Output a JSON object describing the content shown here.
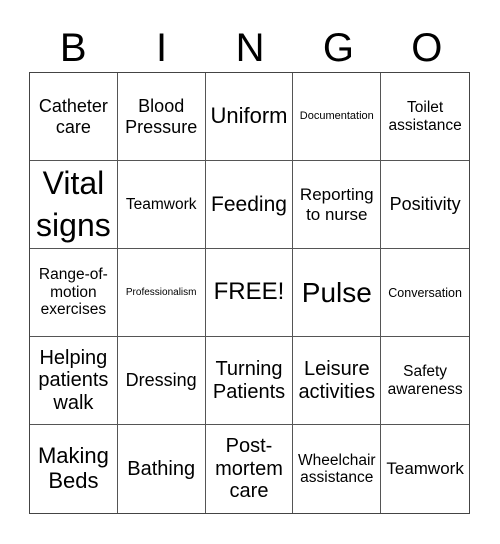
{
  "header": {
    "letters": [
      "B",
      "I",
      "N",
      "G",
      "O"
    ]
  },
  "cells": [
    [
      "Catheter care",
      "Blood Pressure",
      "Uniform",
      "Documentation",
      "Toilet assistance"
    ],
    [
      "Vital signs",
      "Teamwork",
      "Feeding",
      "Reporting to nurse",
      "Positivity"
    ],
    [
      "Range-of-motion exercises",
      "Professionalism",
      "FREE!",
      "Pulse",
      "Conversation"
    ],
    [
      "Helping patients walk",
      "Dressing",
      "Turning Patients",
      "Leisure activities",
      "Safety awareness"
    ],
    [
      "Making Beds",
      "Bathing",
      "Post-mortem care",
      "Wheelchair assistance",
      "Teamwork"
    ]
  ]
}
